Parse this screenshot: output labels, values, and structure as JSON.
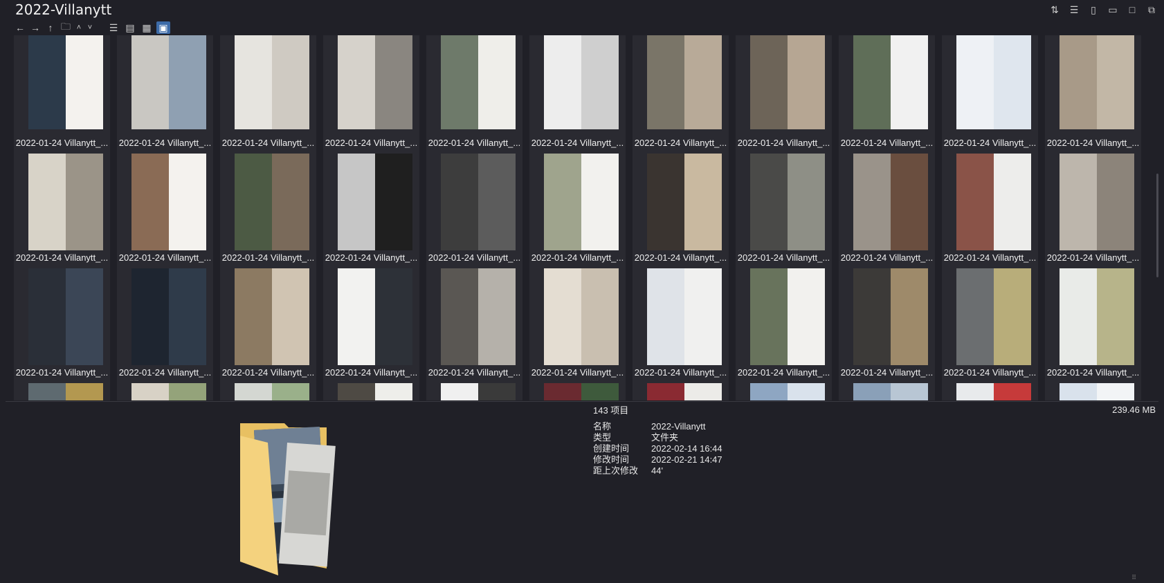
{
  "window": {
    "title": "2022-Villanytt"
  },
  "top_icons": [
    "sort-icon",
    "details-pane-icon",
    "document-icon",
    "page-icon",
    "window-icon",
    "share-icon"
  ],
  "toolbar": {
    "buttons": [
      "back-arrow-icon",
      "forward-arrow-icon",
      "up-arrow-icon",
      "new-folder-icon",
      "chevron-up-icon",
      "chevron-down-icon"
    ],
    "views": [
      {
        "name": "list-view-icon",
        "active": false
      },
      {
        "name": "details-view-icon",
        "active": false
      },
      {
        "name": "tiles-view-icon",
        "active": false
      },
      {
        "name": "thumbnails-view-icon",
        "active": true
      }
    ]
  },
  "grid": {
    "caption": "2022-01-24 Villanytt_...",
    "rows": [
      [
        {
          "left": "#2c3a4a",
          "right": "#f4f2ee"
        },
        {
          "left": "#c9c7c2",
          "right": "#8fa0b2"
        },
        {
          "left": "#e6e4df",
          "right": "#cfcac2"
        },
        {
          "left": "#d6d2cb",
          "right": "#8a8680"
        },
        {
          "left": "#6e7a6a",
          "right": "#efeeea"
        },
        {
          "left": "#ededed",
          "right": "#cfcfcf"
        },
        {
          "left": "#7a7568",
          "right": "#b8aa98"
        },
        {
          "left": "#6d6458",
          "right": "#b6a693"
        },
        {
          "left": "#5f6e58",
          "right": "#f1f1f1"
        },
        {
          "left": "#eef1f5",
          "right": "#dfe6ee"
        },
        {
          "left": "#a89a88",
          "right": "#c2b7a6"
        }
      ],
      [
        {
          "left": "#d8d3c8",
          "right": "#9b9488"
        },
        {
          "left": "#8a6b55",
          "right": "#f4f2ee"
        },
        {
          "left": "#4c5a44",
          "right": "#7a6a5a"
        },
        {
          "left": "#c6c6c6",
          "right": "#1f1f1f"
        },
        {
          "left": "#3d3d3d",
          "right": "#5c5c5c"
        },
        {
          "left": "#9fa48d",
          "right": "#f2f1ee"
        },
        {
          "left": "#3a3430",
          "right": "#c9b9a0"
        },
        {
          "left": "#4a4a48",
          "right": "#8e8f86"
        },
        {
          "left": "#9a938a",
          "right": "#6a4e3f"
        },
        {
          "left": "#8a5348",
          "right": "#ededeb"
        },
        {
          "left": "#bdb6ac",
          "right": "#8c847a"
        }
      ],
      [
        {
          "left": "#2a2f38",
          "right": "#3b4656"
        },
        {
          "left": "#1e2530",
          "right": "#2f3b4a"
        },
        {
          "left": "#8c7a62",
          "right": "#d0c4b2"
        },
        {
          "left": "#f2f2f0",
          "right": "#2d3138"
        },
        {
          "left": "#5a5753",
          "right": "#b5b1aa"
        },
        {
          "left": "#e4ddd2",
          "right": "#c9bfb0"
        },
        {
          "left": "#dfe3e8",
          "right": "#f0f0ef"
        },
        {
          "left": "#68735c",
          "right": "#f2f1ee"
        },
        {
          "left": "#3c3a38",
          "right": "#9e8a6a"
        },
        {
          "left": "#6b6e70",
          "right": "#b8ad7a"
        },
        {
          "left": "#e9ebe8",
          "right": "#b7b48a"
        }
      ],
      [
        {
          "left": "#5e6a70",
          "right": "#b39850"
        },
        {
          "left": "#d8d2c6",
          "right": "#94a37a"
        },
        {
          "left": "#d4d7d2",
          "right": "#9ab08a"
        },
        {
          "left": "#4e4a44",
          "right": "#eeeeea"
        },
        {
          "left": "#f0f0f0",
          "right": "#3a3a3a"
        },
        {
          "left": "#6a2a30",
          "right": "#3e5a3c"
        },
        {
          "left": "#8a2a32",
          "right": "#ecebe8"
        },
        {
          "left": "#8ea6c2",
          "right": "#d9e2ec"
        },
        {
          "left": "#8aa0b8",
          "right": "#b8c6d4"
        },
        {
          "left": "#e8eaec",
          "right": "#c63a3a"
        },
        {
          "left": "#d9e2ec",
          "right": "#f2f4f6"
        }
      ]
    ]
  },
  "status": {
    "count": "143 项目",
    "size": "239.46 MB"
  },
  "properties": [
    {
      "k": "名称",
      "v": "2022-Villanytt"
    },
    {
      "k": "类型",
      "v": "文件夹"
    },
    {
      "k": "创建时间",
      "v": "2022-02-14  16:44"
    },
    {
      "k": "修改时间",
      "v": "2022-02-21  14:47"
    },
    {
      "k": "距上次修改",
      "v": "44'"
    }
  ],
  "folder_preview": {
    "icon": "folder-icon"
  }
}
